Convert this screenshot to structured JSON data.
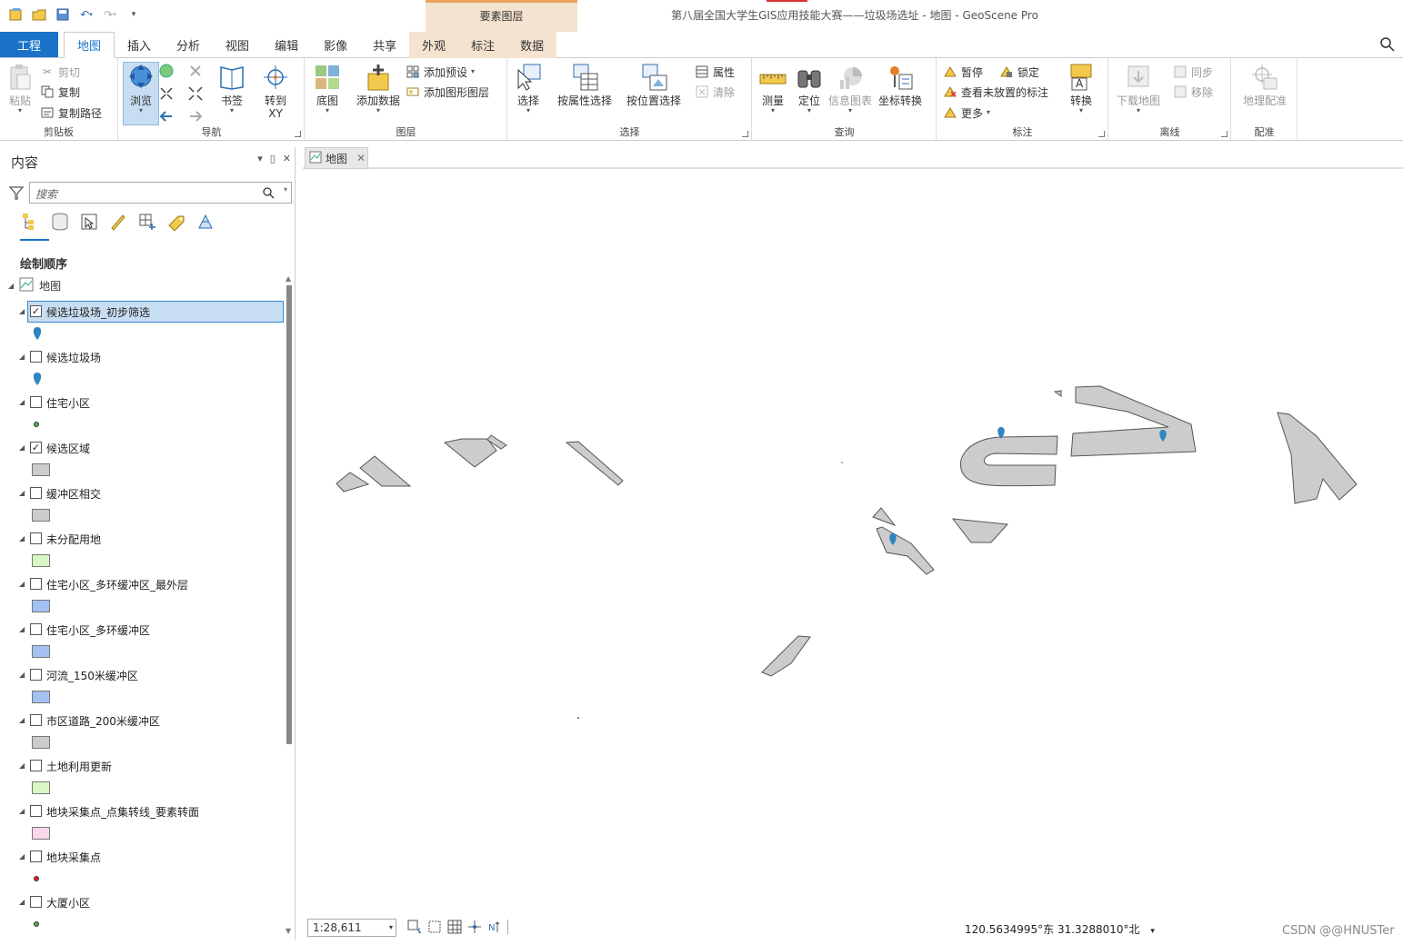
{
  "window": {
    "title": "第八届全国大学生GIS应用技能大赛——垃圾场选址 - 地图 - GeoScene Pro",
    "context_tab_header": "要素图层"
  },
  "tabs": {
    "project": "工程",
    "items": [
      "地图",
      "插入",
      "分析",
      "视图",
      "编辑",
      "影像",
      "共享",
      "外观",
      "标注",
      "数据"
    ],
    "active": "地图"
  },
  "ribbon": {
    "clipboard": {
      "label": "剪贴板",
      "paste": "粘贴",
      "cut": "剪切",
      "copy": "复制",
      "copy_path": "复制路径"
    },
    "navigate": {
      "label": "导航",
      "explore": "浏览",
      "bookmarks": "书签",
      "goto_xy_1": "转到",
      "goto_xy_2": "XY"
    },
    "layer": {
      "label": "图层",
      "basemap": "底图",
      "add_data": "添加数据",
      "add_preset": "添加预设",
      "add_graphics": "添加图形图层"
    },
    "selection": {
      "label": "选择",
      "select": "选择",
      "by_attr": "按属性选择",
      "by_loc": "按位置选择",
      "attributes": "属性",
      "clear": "清除"
    },
    "inquiry": {
      "label": "查询",
      "measure": "测量",
      "locate": "定位",
      "infographics": "信息图表",
      "coord_conv": "坐标转换"
    },
    "labeling": {
      "label": "标注",
      "pause": "暂停",
      "lock": "锁定",
      "unplaced": "查看未放置的标注",
      "more": "更多",
      "convert": "转换"
    },
    "offline": {
      "label": "离线",
      "download": "下载地图",
      "sync": "同步",
      "remove": "移除"
    },
    "georef": {
      "label": "配准",
      "georeference": "地理配准"
    }
  },
  "contents": {
    "title": "内容",
    "search_placeholder": "搜索",
    "draw_order_heading": "绘制顺序",
    "map_node": "地图",
    "layers": [
      {
        "name": "候选垃圾场_初步筛选",
        "checked": true,
        "selected": true,
        "symbol": "pin",
        "color": "#2e86c1"
      },
      {
        "name": "候选垃圾场",
        "checked": false,
        "symbol": "pin",
        "color": "#2e86c1"
      },
      {
        "name": "住宅小区",
        "checked": false,
        "symbol": "dot",
        "color": "#4caf50"
      },
      {
        "name": "候选区域",
        "checked": true,
        "symbol": "rect",
        "color": "#cccccc"
      },
      {
        "name": "缓冲区相交",
        "checked": false,
        "symbol": "rect",
        "color": "#cccccc"
      },
      {
        "name": "未分配用地",
        "checked": false,
        "symbol": "rect",
        "color": "#d8f7c4"
      },
      {
        "name": "住宅小区_多环缓冲区_最外层",
        "checked": false,
        "symbol": "rect",
        "color": "#a3c1f2"
      },
      {
        "name": "住宅小区_多环缓冲区",
        "checked": false,
        "symbol": "rect",
        "color": "#a3c1f2"
      },
      {
        "name": "河流_150米缓冲区",
        "checked": false,
        "symbol": "rect",
        "color": "#a3c1f2"
      },
      {
        "name": "市区道路_200米缓冲区",
        "checked": false,
        "symbol": "rect",
        "color": "#cccccc"
      },
      {
        "name": "土地利用更新",
        "checked": false,
        "symbol": "rect",
        "color": "#d8f7c4"
      },
      {
        "name": "地块采集点_点集转线_要素转面",
        "checked": false,
        "symbol": "rect",
        "color": "#fbd5ea"
      },
      {
        "name": "地块采集点",
        "checked": false,
        "symbol": "dot",
        "color": "#e02020"
      },
      {
        "name": "大厦小区",
        "checked": false,
        "symbol": "dot",
        "color": "#4caf50"
      }
    ]
  },
  "map_view": {
    "tab_label": "地图",
    "scale": "1:28,611",
    "coordinates": "120.5634995°东 31.3288010°北"
  },
  "colors": {
    "accent": "#1b73c9",
    "polygon_fill": "#cccccc",
    "polygon_stroke": "#555555",
    "pin": "#2e86c1"
  },
  "watermark": "CSDN @@HNUSTer"
}
